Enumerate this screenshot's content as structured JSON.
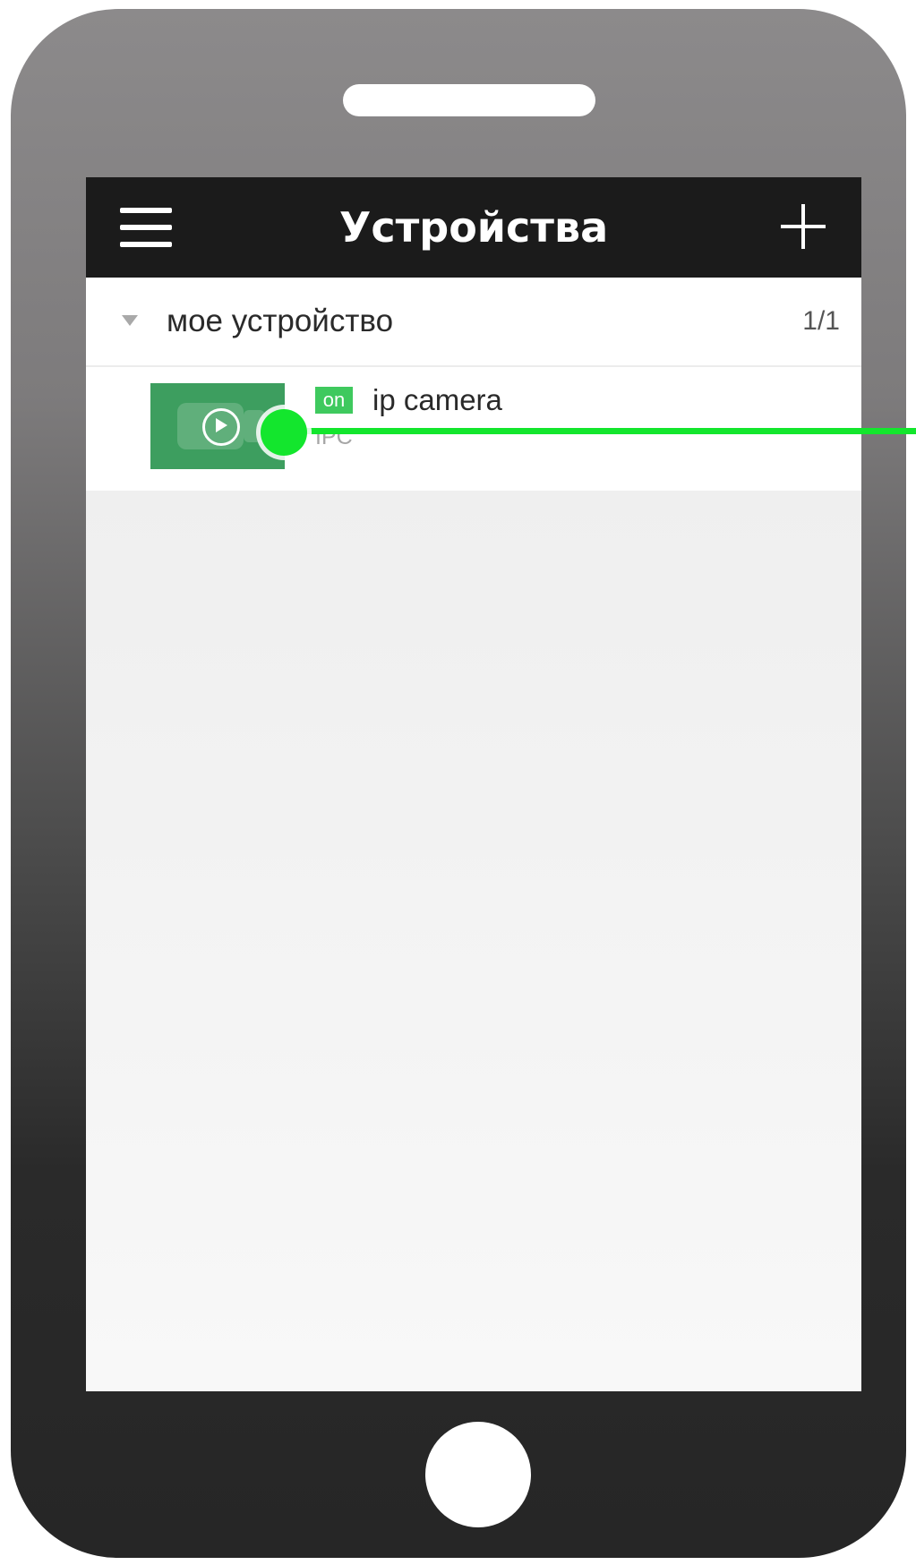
{
  "header": {
    "title": "Устройства"
  },
  "group": {
    "name": "мое устройство",
    "count": "1/1"
  },
  "device": {
    "status": "on",
    "name": "ip camera",
    "type": "IPC"
  },
  "icons": {
    "menu": "hamburger-menu-icon",
    "add": "plus-icon",
    "expand": "triangle-down-icon",
    "play": "play-circle-icon",
    "home": "home-button-icon"
  },
  "colors": {
    "topbar": "#1b1b1b",
    "status_on": "#3fc95e",
    "thumbnail": "#3d9e5f",
    "pointer": "#13e62d"
  }
}
